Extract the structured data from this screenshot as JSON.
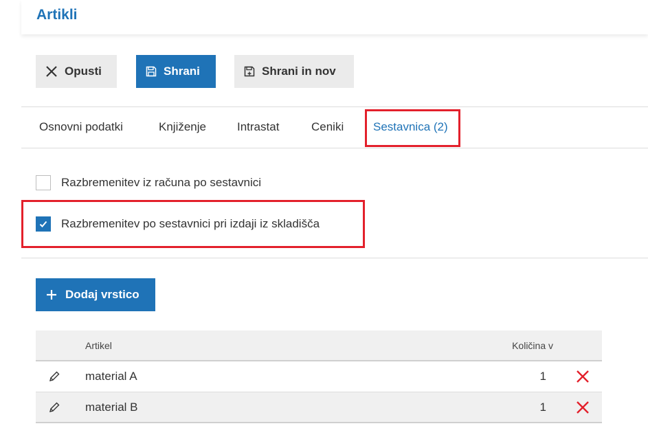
{
  "header": {
    "title": "Artikli"
  },
  "toolbar": {
    "cancel_label": "Opusti",
    "save_label": "Shrani",
    "save_new_label": "Shrani in nov"
  },
  "tabs": [
    {
      "label": "Osnovni podatki",
      "active": false
    },
    {
      "label": "Knjiženje",
      "active": false
    },
    {
      "label": "Intrastat",
      "active": false
    },
    {
      "label": "Ceniki",
      "active": false
    },
    {
      "label": "Sestavnica (2)",
      "active": true
    }
  ],
  "options": [
    {
      "label": "Razbremenitev iz računa po sestavnici",
      "checked": false
    },
    {
      "label": "Razbremenitev po sestavnici pri izdaji iz skladišča",
      "checked": true
    }
  ],
  "add_row_label": "Dodaj vrstico",
  "table": {
    "headers": {
      "article": "Artikel",
      "quantity": "Količina v"
    },
    "rows": [
      {
        "article": "material A",
        "quantity": "1"
      },
      {
        "article": "material B",
        "quantity": "1"
      }
    ]
  },
  "colors": {
    "accent": "#1f73b7",
    "highlight": "#e3202b",
    "delete": "#e3202b"
  },
  "icons": {
    "cancel": "close-icon",
    "save": "floppy-disk-icon",
    "save_new": "floppy-disk-plus-icon",
    "add": "plus-icon",
    "edit": "pencil-icon",
    "delete": "delete-x-icon",
    "checkbox": "check-icon"
  }
}
